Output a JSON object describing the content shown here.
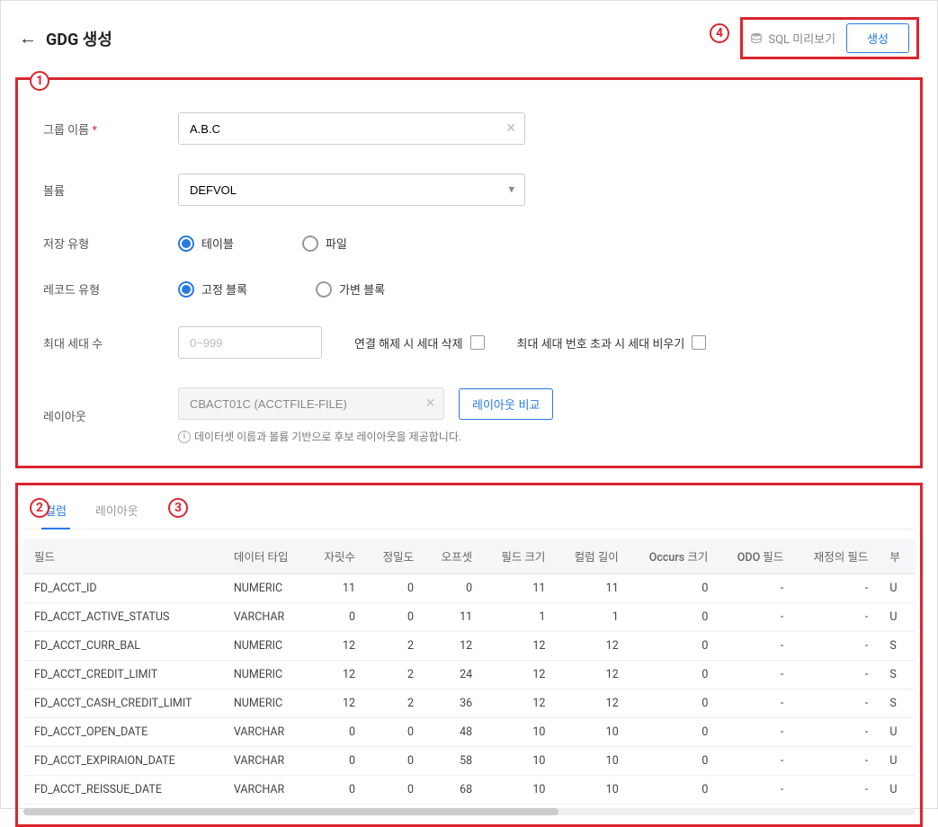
{
  "header": {
    "title": "GDG 생성",
    "sql_preview": "SQL 미리보기",
    "create_btn": "생성"
  },
  "annotations": {
    "a1": "1",
    "a2": "2",
    "a3": "3",
    "a4": "4"
  },
  "form": {
    "group_name_label": "그룹 이름",
    "group_name_value": "A.B.C",
    "volume_label": "볼륨",
    "volume_value": "DEFVOL",
    "storage_type_label": "저장 유형",
    "storage_type_table": "테이블",
    "storage_type_file": "파일",
    "record_type_label": "레코드 유형",
    "record_type_fixed": "고정 블록",
    "record_type_var": "가변 블록",
    "max_gen_label": "최대 세대 수",
    "max_gen_placeholder": "0~999",
    "chk1_label": "연결 해제 시 세대 삭제",
    "chk2_label": "최대 세대 번호 초과 시 세대 비우기",
    "layout_label": "레이아웃",
    "layout_value": "CBACT01C (ACCTFILE-FILE)",
    "compare_btn": "레이아웃 비교",
    "layout_hint": "데이터셋 이름과 볼륨 기반으로 후보 레이아웃을 제공합니다."
  },
  "tabs": {
    "column": "컬럼",
    "layout": "레이아웃"
  },
  "table": {
    "headers": {
      "field": "필드",
      "data_type": "데이터 타입",
      "digits": "자릿수",
      "precision": "정밀도",
      "offset": "오프셋",
      "field_size": "필드 크기",
      "column_len": "컬럼 길이",
      "occurs_size": "Occurs 크기",
      "odo_field": "ODO 필드",
      "redef_field": "재정의 필드",
      "extra": "부"
    },
    "rows": [
      {
        "field": "FD_ACCT_ID",
        "type": "NUMERIC",
        "digits": "11",
        "prec": "0",
        "off": "0",
        "fsize": "11",
        "clen": "11",
        "occ": "0",
        "odo": "-",
        "redef": "-",
        "extra": "U"
      },
      {
        "field": "FD_ACCT_ACTIVE_STATUS",
        "type": "VARCHAR",
        "digits": "0",
        "prec": "0",
        "off": "11",
        "fsize": "1",
        "clen": "1",
        "occ": "0",
        "odo": "-",
        "redef": "-",
        "extra": "U"
      },
      {
        "field": "FD_ACCT_CURR_BAL",
        "type": "NUMERIC",
        "digits": "12",
        "prec": "2",
        "off": "12",
        "fsize": "12",
        "clen": "12",
        "occ": "0",
        "odo": "-",
        "redef": "-",
        "extra": "S"
      },
      {
        "field": "FD_ACCT_CREDIT_LIMIT",
        "type": "NUMERIC",
        "digits": "12",
        "prec": "2",
        "off": "24",
        "fsize": "12",
        "clen": "12",
        "occ": "0",
        "odo": "-",
        "redef": "-",
        "extra": "S"
      },
      {
        "field": "FD_ACCT_CASH_CREDIT_LIMIT",
        "type": "NUMERIC",
        "digits": "12",
        "prec": "2",
        "off": "36",
        "fsize": "12",
        "clen": "12",
        "occ": "0",
        "odo": "-",
        "redef": "-",
        "extra": "S"
      },
      {
        "field": "FD_ACCT_OPEN_DATE",
        "type": "VARCHAR",
        "digits": "0",
        "prec": "0",
        "off": "48",
        "fsize": "10",
        "clen": "10",
        "occ": "0",
        "odo": "-",
        "redef": "-",
        "extra": "U"
      },
      {
        "field": "FD_ACCT_EXPIRAION_DATE",
        "type": "VARCHAR",
        "digits": "0",
        "prec": "0",
        "off": "58",
        "fsize": "10",
        "clen": "10",
        "occ": "0",
        "odo": "-",
        "redef": "-",
        "extra": "U"
      },
      {
        "field": "FD_ACCT_REISSUE_DATE",
        "type": "VARCHAR",
        "digits": "0",
        "prec": "0",
        "off": "68",
        "fsize": "10",
        "clen": "10",
        "occ": "0",
        "odo": "-",
        "redef": "-",
        "extra": "U"
      }
    ]
  }
}
